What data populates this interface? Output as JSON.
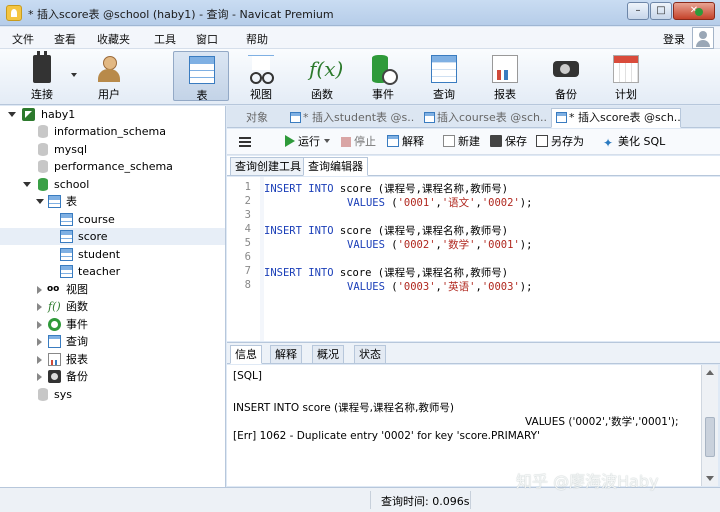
{
  "window": {
    "title": "* 插入score表 @school (haby1) - 查询 - Navicat Premium",
    "min_label": "–",
    "max_label": "□",
    "close_label": "✕"
  },
  "menu": {
    "items": [
      "文件",
      "查看",
      "收藏夹",
      "工具",
      "窗口",
      "帮助"
    ],
    "login": "登录"
  },
  "toolbar": {
    "items": [
      {
        "label": "连接",
        "icon": "connection-icon"
      },
      {
        "label": "用户",
        "icon": "user-icon"
      },
      {
        "label": "表",
        "icon": "table-icon",
        "active": true
      },
      {
        "label": "视图",
        "icon": "view-icon"
      },
      {
        "label": "函数",
        "icon": "function-icon"
      },
      {
        "label": "事件",
        "icon": "event-icon"
      },
      {
        "label": "查询",
        "icon": "query-icon"
      },
      {
        "label": "报表",
        "icon": "report-icon"
      },
      {
        "label": "备份",
        "icon": "backup-icon"
      },
      {
        "label": "计划",
        "icon": "schedule-icon"
      }
    ]
  },
  "nav": {
    "connection": "haby1",
    "databases": [
      "information_schema",
      "mysql",
      "performance_schema",
      "school",
      "sys"
    ],
    "school_children": {
      "tables_label": "表",
      "tables": [
        "course",
        "score",
        "student",
        "teacher"
      ],
      "selected_table": "score",
      "groups": [
        "视图",
        "函数",
        "事件",
        "查询",
        "报表",
        "备份"
      ]
    }
  },
  "tabs": [
    {
      "label": "对象"
    },
    {
      "label": "* 插入student表 @s..."
    },
    {
      "label": "插入course表 @sch..."
    },
    {
      "label": "* 插入score表 @sch...",
      "active": true
    }
  ],
  "editor_toolbar": {
    "run": "运行",
    "stop": "停止",
    "explain": "解释",
    "new": "新建",
    "save": "保存",
    "save_as": "另存为",
    "beautify": "美化 SQL"
  },
  "subtabs": [
    "查询创建工具",
    "查询编辑器"
  ],
  "code": {
    "line_numbers": [
      "1",
      "2",
      "3",
      "4",
      "5",
      "6",
      "7",
      "8"
    ],
    "lines": [
      {
        "kw1": "INSERT INTO",
        "rest": " score (课程号,课程名称,教师号)"
      },
      {
        "kw1": "VALUES",
        "rest": " (",
        "s1": "'0001'",
        "c1": ",",
        "s2": "'语文'",
        "c2": ",",
        "s3": "'0002'",
        "end": ");"
      },
      {
        "kw1": "INSERT INTO",
        "rest": " score (课程号,课程名称,教师号)"
      },
      {
        "kw1": "VALUES",
        "rest": " (",
        "s1": "'0002'",
        "c1": ",",
        "s2": "'数学'",
        "c2": ",",
        "s3": "'0001'",
        "end": ");"
      },
      {
        "kw1": "INSERT INTO",
        "rest": " score (课程号,课程名称,教师号)"
      },
      {
        "kw1": "VALUES",
        "rest": " (",
        "s1": "'0003'",
        "c1": ",",
        "s2": "'英语'",
        "c2": ",",
        "s3": "'0003'",
        "end": ");"
      }
    ]
  },
  "bottom_tabs": [
    "信息",
    "解释",
    "概况",
    "状态"
  ],
  "info": {
    "sql_tag": "[SQL]",
    "line1": "INSERT INTO score (课程号,课程名称,教师号)",
    "line2": "VALUES ('0002','数学','0001');",
    "error": "[Err] 1062 - Duplicate entry '0002' for key 'score.PRIMARY'"
  },
  "status": {
    "query_time": "查询时间: 0.096s"
  },
  "watermark": "知乎 @廖海波Haby"
}
